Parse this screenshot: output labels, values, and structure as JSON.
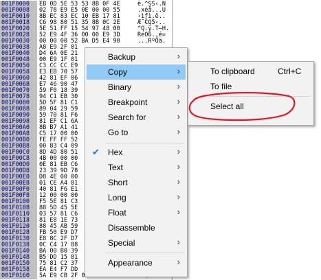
{
  "dump": {
    "rows": [
      {
        "addr": "001F0000",
        "hex": "EB 0D 5E 53 53 8B 0F 4E",
        "ascii": "ë.^SS‹.N"
      },
      {
        "addr": "001F0008",
        "hex": "02 78 E9 E5 0E 00 00 55",
        "ascii": ".xéå...U"
      },
      {
        "addr": "001F0010",
        "hex": "8B EC 83 EC 10 EB 17 81",
        "ascii": "‹ìƒì.ë.."
      },
      {
        "addr": "001F0018",
        "hex": "C6 98 80 51 35 8B 0C 2E",
        "ascii": "Æ˜€Q5‹.."
      },
      {
        "addr": "001F0020",
        "hex": "5E 51 FF 15 54 97 48 00",
        "ascii": "^Q.ÿ.T—H."
      },
      {
        "addr": "001F0028",
        "hex": "52 E9 4F 36 00 00 E9 3D",
        "ascii": "RéO6..é="
      },
      {
        "addr": "001F0030",
        "hex": "00 00 00 52 BA D5 E4 90",
        "ascii": "...RºÕä."
      },
      {
        "addr": "001F0038",
        "hex": "A8 E9 2F 01",
        "ascii": ""
      },
      {
        "addr": "001F0040",
        "hex": "D4 6A 0E 21",
        "ascii": ""
      },
      {
        "addr": "001F0048",
        "hex": "00 E9 1F 01",
        "ascii": ""
      },
      {
        "addr": "001F0050",
        "hex": "C3 CC CC E9",
        "ascii": ""
      },
      {
        "addr": "001F0058",
        "hex": "E3 EB 70 57",
        "ascii": ""
      },
      {
        "addr": "001F0060",
        "hex": "42 81 EF 06",
        "ascii": ""
      },
      {
        "addr": "001F0068",
        "hex": "E7 46 90 47",
        "ascii": ""
      },
      {
        "addr": "001F0070",
        "hex": "59 F0 18 39",
        "ascii": ""
      },
      {
        "addr": "001F0078",
        "hex": "94 C1 EB 30",
        "ascii": ""
      },
      {
        "addr": "001F0080",
        "hex": "5D 5F 81 C1",
        "ascii": ""
      },
      {
        "addr": "001F0088",
        "hex": "89 04 29 59",
        "ascii": ""
      },
      {
        "addr": "001F0090",
        "hex": "59 70 81 F6",
        "ascii": ""
      },
      {
        "addr": "001F0098",
        "hex": "81 EF C1 6A",
        "ascii": ""
      },
      {
        "addr": "001F00A0",
        "hex": "8B B7 A1 41",
        "ascii": ""
      },
      {
        "addr": "001F00A8",
        "hex": "C5 17 00 00",
        "ascii": ""
      },
      {
        "addr": "001F00B0",
        "hex": "FE FF FF 52",
        "ascii": ""
      },
      {
        "addr": "001F00B8",
        "hex": "00 83 C4 09",
        "ascii": ""
      },
      {
        "addr": "001F00C0",
        "hex": "8D 4D 80 51",
        "ascii": ""
      },
      {
        "addr": "001F00C8",
        "hex": "4B 00 00 00",
        "ascii": ""
      },
      {
        "addr": "001F00D0",
        "hex": "0E 81 EB C6",
        "ascii": ""
      },
      {
        "addr": "001F00D8",
        "hex": "23 39 9D 78",
        "ascii": ""
      },
      {
        "addr": "001F00E0",
        "hex": "D8 4E 00 00",
        "ascii": ""
      },
      {
        "addr": "001F00E8",
        "hex": "01 CE A4 81",
        "ascii": ""
      },
      {
        "addr": "001F00F0",
        "hex": "40 81 F6 E1",
        "ascii": ""
      },
      {
        "addr": "001F00F8",
        "hex": "12 00 00 00",
        "ascii": ""
      },
      {
        "addr": "001F0100",
        "hex": "F5 5E 81 C3",
        "ascii": ""
      },
      {
        "addr": "001F0108",
        "hex": "88 5D 45 5E",
        "ascii": ""
      },
      {
        "addr": "001F0110",
        "hex": "03 57 81 C6",
        "ascii": ""
      },
      {
        "addr": "001F0118",
        "hex": "81 E8 1E 73",
        "ascii": ""
      },
      {
        "addr": "001F0120",
        "hex": "88 45 AB 59",
        "ascii": ""
      },
      {
        "addr": "001F0128",
        "hex": "FB 50 E9 D7",
        "ascii": ""
      },
      {
        "addr": "001F0130",
        "hex": "E8 8C 2F D7",
        "ascii": ""
      },
      {
        "addr": "001F0138",
        "hex": "0C C4 17 88",
        "ascii": ""
      },
      {
        "addr": "001F0140",
        "hex": "BA 00 B0 39",
        "ascii": ""
      },
      {
        "addr": "001F0148",
        "hex": "B5 DD 15 81",
        "ascii": ""
      },
      {
        "addr": "001F0150",
        "hex": "75 81 C2 37",
        "ascii": ""
      },
      {
        "addr": "001F0158",
        "hex": "EA E4 F7 DD",
        "ascii": ""
      },
      {
        "addr": "001F0160",
        "hex": "5A E9 CB 2F 00 00 CC CC",
        "ascii": "Zé˫/..ÌÌ"
      }
    ]
  },
  "context_menu": {
    "items": [
      {
        "label": "Backup",
        "has_submenu": true
      },
      {
        "label": "Copy",
        "has_submenu": true,
        "highlighted": true
      },
      {
        "label": "Binary",
        "has_submenu": true
      },
      {
        "label": "Breakpoint",
        "has_submenu": true
      },
      {
        "label": "Search for",
        "has_submenu": true
      },
      {
        "label": "Go to",
        "has_submenu": true
      },
      {
        "label": "Hex",
        "has_submenu": true,
        "checked": true
      },
      {
        "label": "Text",
        "has_submenu": true
      },
      {
        "label": "Short",
        "has_submenu": true
      },
      {
        "label": "Long",
        "has_submenu": true
      },
      {
        "label": "Float",
        "has_submenu": true
      },
      {
        "label": "Disassemble",
        "has_submenu": false
      },
      {
        "label": "Special",
        "has_submenu": true
      },
      {
        "label": "Appearance",
        "has_submenu": true
      }
    ],
    "arrow_glyph": "›",
    "check_glyph": "✔"
  },
  "copy_submenu": {
    "items": [
      {
        "label": "To clipboard",
        "shortcut": "Ctrl+C"
      },
      {
        "label": "To file",
        "shortcut": ""
      },
      {
        "label": "Select all",
        "shortcut": ""
      }
    ]
  },
  "colors": {
    "highlight": "#91c9f7",
    "address_bg": "#c0c0c0",
    "address_text": "#000080",
    "annotation": "#e8141c"
  }
}
